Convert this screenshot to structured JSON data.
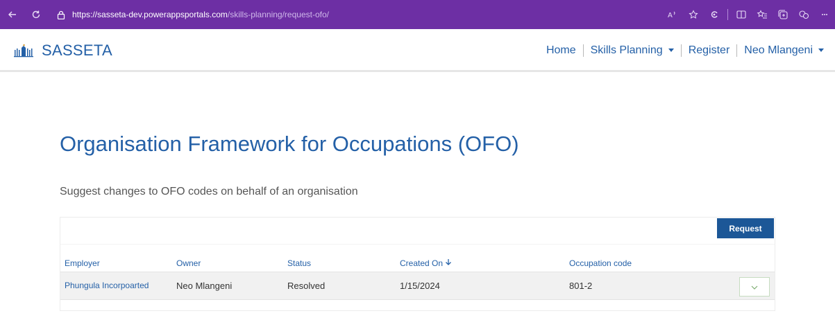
{
  "browser": {
    "url_host": "https://sasseta-dev.powerappsportals.com",
    "url_path": "/skills-planning/request-ofo/",
    "icons": [
      "back-icon",
      "reload-icon",
      "lock-icon",
      "read-aloud-icon",
      "favorite-icon",
      "extensions-icon",
      "split-screen-icon",
      "favorites-bar-icon",
      "collections-icon",
      "profile-icon",
      "more-icon"
    ],
    "theme_color": "#6d2fa4"
  },
  "header": {
    "brand_name": "SASSETA",
    "nav": {
      "home": "Home",
      "skills_planning": "Skills Planning",
      "register": "Register",
      "user": "Neo Mlangeni"
    },
    "accent_color": "#2460a7"
  },
  "main": {
    "title": "Organisation Framework for Occupations (OFO)",
    "subtitle": "Suggest changes to OFO codes on behalf of an organisation",
    "request_button": "Request",
    "columns": {
      "employer": "Employer",
      "owner": "Owner",
      "status": "Status",
      "created_on": "Created On",
      "occupation_code": "Occupation code"
    },
    "rows": [
      {
        "employer": "Phungula Incorpoarted",
        "owner": "Neo Mlangeni",
        "status": "Resolved",
        "created_on": "1/15/2024",
        "occupation_code": "801-2"
      }
    ],
    "button_color": "#1c5797"
  }
}
